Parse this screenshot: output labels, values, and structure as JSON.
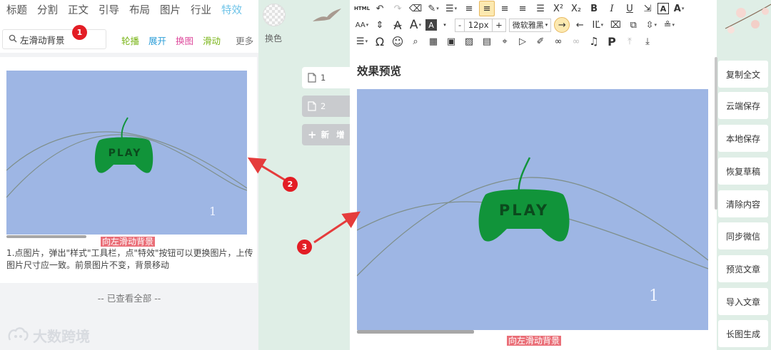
{
  "left_panel": {
    "tabs": [
      "标题",
      "分割",
      "正文",
      "引导",
      "布局",
      "图片",
      "行业",
      "特效"
    ],
    "active_tab": "特效",
    "swap_label": "换色",
    "search": {
      "value": "左滑动背景"
    },
    "subtabs": [
      {
        "label": "轮播",
        "color": "#7ab518"
      },
      {
        "label": "展开",
        "color": "#2f9fd8"
      },
      {
        "label": "换图",
        "color": "#de4a9c"
      },
      {
        "label": "滑动",
        "color": "#7ab518"
      },
      {
        "label": "更多",
        "color": "#777777"
      }
    ],
    "card": {
      "pink_label": "向左滑动背景",
      "description": "1.点图片，弹出\"样式\"工具栏，点\"特效\"按钮可以更换图片，上传图片尺寸应一致。前景图片不变，背景移动",
      "image_text": "PLAY",
      "image_number": "1"
    },
    "viewed_all": "-- 已查看全部 --",
    "watermark": "大数跨境"
  },
  "annotations": [
    "1",
    "2",
    "3"
  ],
  "pages": {
    "items": [
      "1",
      "2"
    ],
    "add_label": "新 增"
  },
  "editor": {
    "toolbar": {
      "font_size": "12px",
      "font_family": "微软雅黑"
    },
    "preview_title": "效果预览",
    "image_text": "PLAY",
    "image_number": "1",
    "pink_label": "向左滑动背景"
  },
  "side_buttons": [
    "复制全文",
    "云端保存",
    "本地保存",
    "恢复草稿",
    "清除内容",
    "同步微信",
    "预览文章",
    "导入文章",
    "长图生成"
  ],
  "colors": {
    "accent": "#6dc3e8",
    "preview_bg": "#9eb6e4",
    "controller": "#11943a",
    "badge": "#e31d25",
    "arrow": "#e53c3c"
  }
}
